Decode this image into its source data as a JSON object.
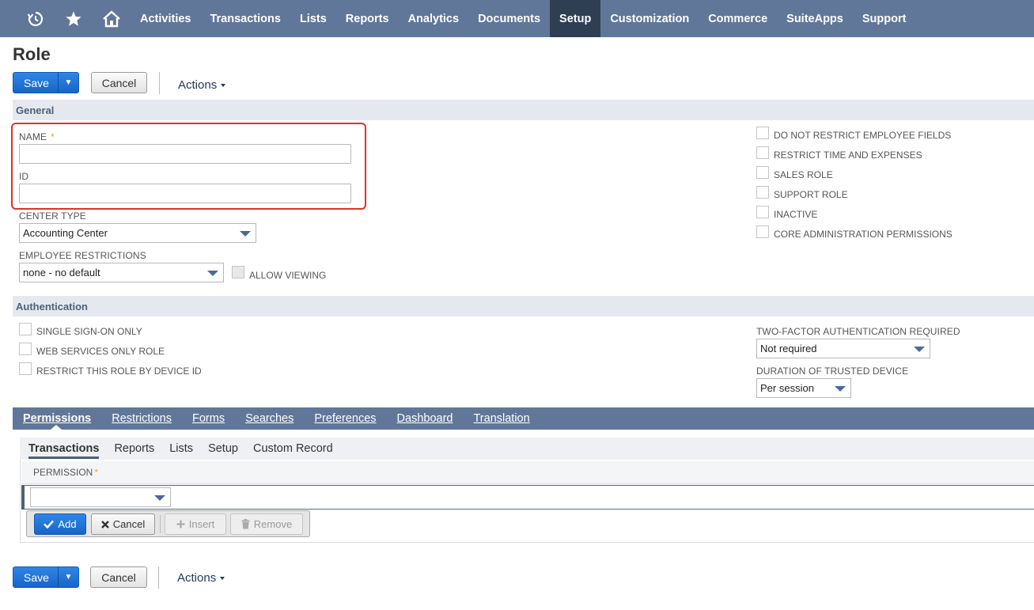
{
  "nav": {
    "icons": [
      "recent-records-icon",
      "star-icon",
      "home-icon"
    ],
    "items": [
      {
        "label": "Activities"
      },
      {
        "label": "Transactions"
      },
      {
        "label": "Lists"
      },
      {
        "label": "Reports"
      },
      {
        "label": "Analytics"
      },
      {
        "label": "Documents"
      },
      {
        "label": "Setup",
        "active": true
      },
      {
        "label": "Customization"
      },
      {
        "label": "Commerce"
      },
      {
        "label": "SuiteApps"
      },
      {
        "label": "Support"
      }
    ]
  },
  "page": {
    "title": "Role"
  },
  "toolbar": {
    "save_label": "Save",
    "cancel_label": "Cancel",
    "actions_label": "Actions"
  },
  "sections": {
    "general": "General",
    "authentication": "Authentication"
  },
  "general": {
    "name_label": "NAME",
    "required_mark": "*",
    "name_value": "",
    "id_label": "ID",
    "id_value": "",
    "center_type_label": "CENTER TYPE",
    "center_type_value": "Accounting Center",
    "employee_restrictions_label": "EMPLOYEE RESTRICTIONS",
    "employee_restrictions_value": "none - no default",
    "allow_viewing_label": "ALLOW VIEWING",
    "checkboxes": [
      "DO NOT RESTRICT EMPLOYEE FIELDS",
      "RESTRICT TIME AND EXPENSES",
      "SALES ROLE",
      "SUPPORT ROLE",
      "INACTIVE",
      "CORE ADMINISTRATION PERMISSIONS"
    ]
  },
  "authentication": {
    "checkboxes": [
      "SINGLE SIGN-ON ONLY",
      "WEB SERVICES ONLY ROLE",
      "RESTRICT THIS ROLE BY DEVICE ID"
    ],
    "two_factor_label": "TWO-FACTOR AUTHENTICATION REQUIRED",
    "two_factor_value": "Not required",
    "duration_label": "DURATION OF TRUSTED DEVICE",
    "duration_value": "Per session"
  },
  "tabs": [
    "Permissions",
    "Restrictions",
    "Forms",
    "Searches",
    "Preferences",
    "Dashboard",
    "Translation"
  ],
  "subtabs": [
    "Transactions",
    "Reports",
    "Lists",
    "Setup",
    "Custom Record"
  ],
  "permissions": {
    "column_header": "PERMISSION",
    "required_mark": "*",
    "select_value": "",
    "buttons": {
      "add": "Add",
      "cancel": "Cancel",
      "insert": "Insert",
      "remove": "Remove"
    }
  },
  "colors": {
    "nav_bg": "#607799",
    "nav_active": "#2f3f53",
    "primary_button": "#1e6fd9",
    "highlight_border": "#e0302a"
  }
}
